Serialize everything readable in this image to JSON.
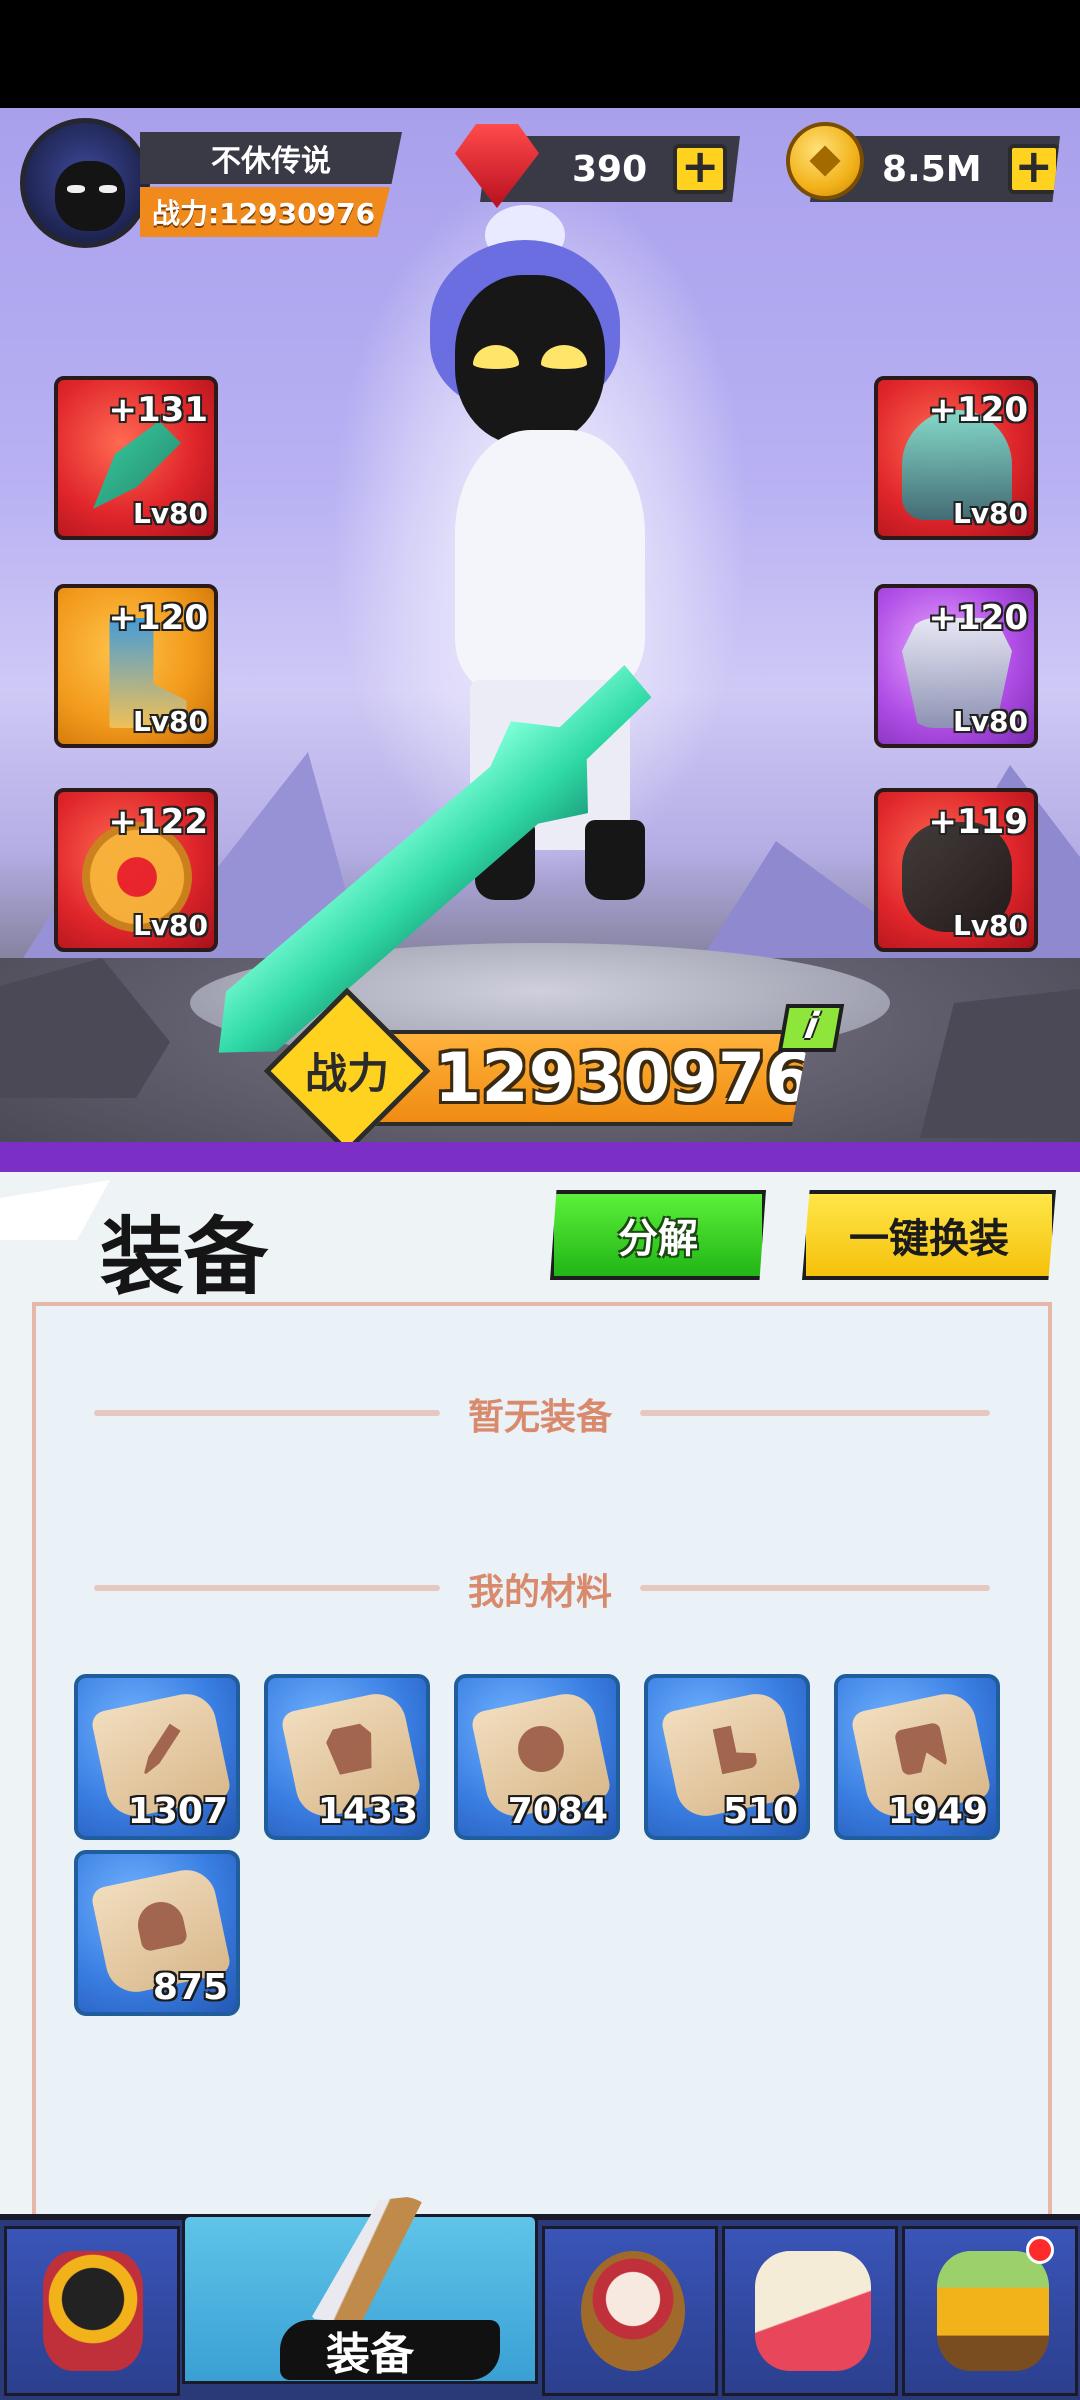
{
  "player": {
    "name": "不休传说",
    "power_label": "战力:12930976"
  },
  "currency": {
    "gems": "390",
    "coins": "8.5M"
  },
  "equipment": [
    {
      "slot": "weapon",
      "plus": "+131",
      "level": "Lv80",
      "rarity": "red"
    },
    {
      "slot": "boots",
      "plus": "+120",
      "level": "Lv80",
      "rarity": "orange"
    },
    {
      "slot": "ring",
      "plus": "+122",
      "level": "Lv80",
      "rarity": "red"
    },
    {
      "slot": "helmet",
      "plus": "+120",
      "level": "Lv80",
      "rarity": "red"
    },
    {
      "slot": "armor",
      "plus": "+120",
      "level": "Lv80",
      "rarity": "purple"
    },
    {
      "slot": "gloves",
      "plus": "+119",
      "level": "Lv80",
      "rarity": "red"
    }
  ],
  "combat": {
    "tag": "战力",
    "value": "12930976",
    "info": "i"
  },
  "panel": {
    "title": "装备",
    "decompose_button": "分解",
    "auto_equip_button": "一键换装",
    "no_equipment": "暂无装备",
    "materials_heading": "我的材料"
  },
  "materials": [
    {
      "icon": "sword-scroll-icon",
      "count": "1307"
    },
    {
      "icon": "armor-scroll-icon",
      "count": "1433"
    },
    {
      "icon": "ring-scroll-icon",
      "count": "7084"
    },
    {
      "icon": "boots-scroll-icon",
      "count": "510"
    },
    {
      "icon": "gloves-scroll-icon",
      "count": "1949"
    },
    {
      "icon": "helmet-scroll-icon",
      "count": "875"
    }
  ],
  "nav": {
    "active_label": "装备",
    "items": [
      "hero-nav-icon",
      "equipment-nav-icon",
      "drum-nav-icon",
      "scroll-nav-icon",
      "treasure-nav-icon"
    ]
  },
  "colors": {
    "gold_accent": "#f08b12",
    "green_button": "#21b516",
    "yellow_button": "#f5c10b",
    "material_blue": "#3a7ee2",
    "notification_red": "#ff2b2b"
  }
}
